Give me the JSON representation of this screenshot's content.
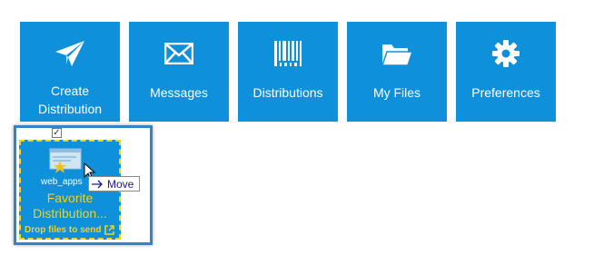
{
  "tiles": [
    {
      "label_line1": "Create",
      "label_line2": "Distribution",
      "icon": "send-icon"
    },
    {
      "label": "Messages",
      "icon": "envelope-icon"
    },
    {
      "label": "Distributions",
      "icon": "barcode-icon"
    },
    {
      "label": "My Files",
      "icon": "folder-icon"
    },
    {
      "label": "Preferences",
      "icon": "gear-icon"
    }
  ],
  "favorite": {
    "title_line1": "Favorite",
    "title_line2": "Distribution...",
    "drop_label": "Drop files to send",
    "checked": true,
    "check_glyph": "✓"
  },
  "drag": {
    "file_name": "web_apps",
    "tooltip": "Move",
    "tooltip_icon": "arrow-right-icon"
  },
  "colors": {
    "tile_bg": "#0E90DB",
    "tile_text": "#FFFFFF",
    "favorite_text": "#F2D21B",
    "selection_border": "#2E86C7"
  }
}
